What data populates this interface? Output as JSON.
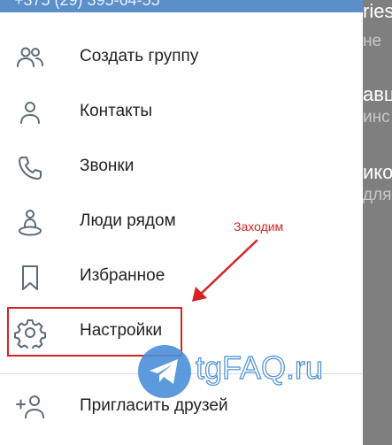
{
  "header": {
    "phone": "+375 (29) 395-64-55"
  },
  "menu": [
    {
      "label": "Создать группу",
      "icon": "group-icon"
    },
    {
      "label": "Контакты",
      "icon": "contact-icon"
    },
    {
      "label": "Звонки",
      "icon": "phone-icon"
    },
    {
      "label": "Люди рядом",
      "icon": "people-nearby-icon"
    },
    {
      "label": "Избранное",
      "icon": "bookmark-icon"
    },
    {
      "label": "Настройки",
      "icon": "gear-icon"
    },
    {
      "label": "Пригласить друзей",
      "icon": "add-user-icon"
    }
  ],
  "annotation": {
    "text": "Заходим",
    "color": "#d62424"
  },
  "watermark": {
    "text": "tgFAQ.ru"
  },
  "background_chat": {
    "fragments": [
      "ries",
      "не",
      "авц",
      "инс",
      "ико",
      "для"
    ]
  },
  "colors": {
    "header": "#5b8fc9",
    "icon": "#5a6b7a",
    "highlight": "#d62424",
    "accent": "#4a8fd9"
  }
}
